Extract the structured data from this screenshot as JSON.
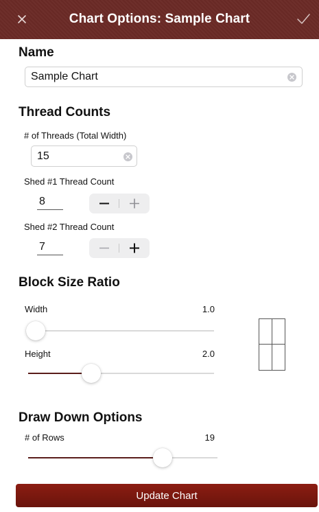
{
  "header": {
    "title": "Chart Options: Sample Chart",
    "close_icon": "close-icon",
    "confirm_icon": "checkmark-icon",
    "color": "#6b2a26"
  },
  "name_section": {
    "title": "Name",
    "value": "Sample Chart"
  },
  "thread_counts": {
    "title": "Thread Counts",
    "total_width_label": "# of Threads (Total Width)",
    "total_width_value": "15",
    "shed1_label": "Shed #1 Thread Count",
    "shed1_value": "8",
    "shed2_label": "Shed #2 Thread Count",
    "shed2_value": "7",
    "minus_symbol": "−",
    "plus_symbol": "+"
  },
  "block_size": {
    "title": "Block Size Ratio",
    "width_label": "Width",
    "width_value": "1.0",
    "width_fraction": 0.0,
    "height_label": "Height",
    "height_value": "2.0",
    "height_fraction": 0.34
  },
  "draw_down": {
    "title": "Draw Down Options",
    "rows_label": "# of Rows",
    "rows_value": "19",
    "rows_fraction": 0.71
  },
  "footer": {
    "update_label": "Update Chart",
    "accent_color": "#7a1a10"
  }
}
